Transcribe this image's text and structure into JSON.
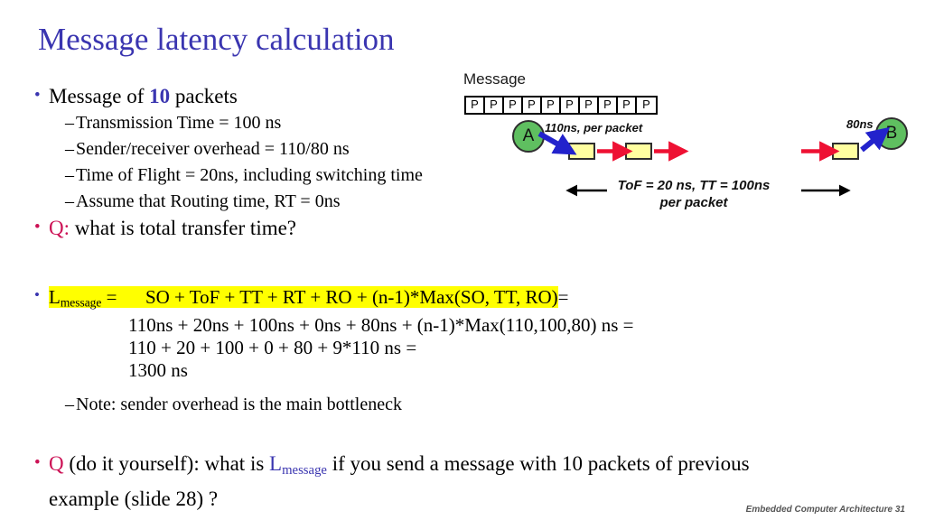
{
  "slide": {
    "title": "Message latency calculation",
    "footer": "Embedded Computer Architecture  31"
  },
  "colors": {
    "title_blue": "#3a35b0",
    "accent_red": "#cc1155",
    "highlight_yellow": "#ffff00",
    "node_green": "#5fbf60",
    "box_yellow": "#ffffa0",
    "arrow_red": "#ee1133",
    "arrow_blue": "#2222cc"
  },
  "bullets": {
    "b1_pre": "Message of ",
    "b1_num": "10",
    "b1_post": " packets",
    "sub": [
      "Transmission Time = 100 ns",
      "Sender/receiver overhead = 110/80 ns",
      "Time of Flight = 20ns, including switching time",
      "Assume that Routing time, RT = 0ns"
    ],
    "q1_label": "Q",
    "q1_colon": ":",
    "q1_text": " what is total transfer time?"
  },
  "formula": {
    "lhs_L": "L",
    "lhs_sub": "message",
    "lhs_eq": " =",
    "highlight_expr": "SO + ToF + TT + RT + RO + (n-1)*Max(SO, TT, RO)",
    "trailing_eq": "=",
    "lines": [
      "110ns + 20ns + 100ns + 0ns + 80ns + (n-1)*Max(110,100,80) ns =",
      "110 + 20 + 100 + 0 + 80 + 9*110 ns =",
      "1300 ns"
    ],
    "note_dash": "–",
    "note": "Note: sender overhead is the main bottleneck"
  },
  "final_question": {
    "q_label": "Q",
    "part1": " (do it yourself): what is ",
    "L": "L",
    "L_sub": "message",
    "part2": "  if you send a message with 10 packets of previous",
    "part3": "example (slide 28) ?"
  },
  "diagram": {
    "message_label": "Message",
    "packets": [
      "P",
      "P",
      "P",
      "P",
      "P",
      "P",
      "P",
      "P",
      "P",
      "P"
    ],
    "node_a": "A",
    "node_b": "B",
    "label_sender": "110ns, per packet",
    "label_receiver": "80ns",
    "tof_line1": "ToF = 20 ns, TT = 100ns",
    "tof_line2": "per packet"
  }
}
